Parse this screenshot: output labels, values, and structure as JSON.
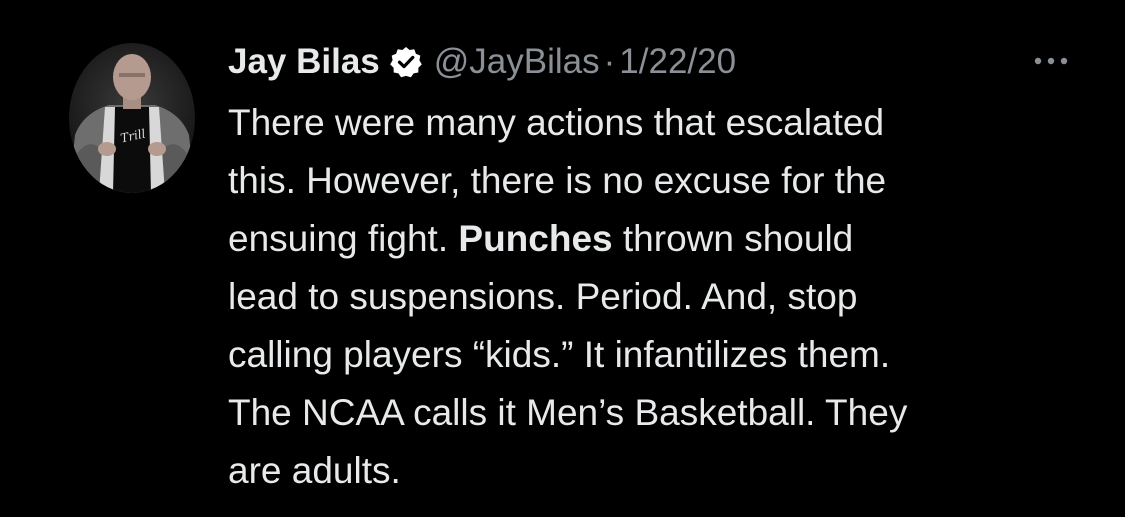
{
  "author": {
    "name": "Jay Bilas",
    "handle": "@JayBilas",
    "separator": "·",
    "date": "1/22/20",
    "verified": true,
    "avatar_icon": "profile-photo-icon",
    "avatar_shirt_text": "Trill"
  },
  "tweet": {
    "lines": [
      "There were many actions that escalated",
      "this. However, there is no excuse for the",
      "ensuing fight.",
      "Punches",
      "thrown should",
      "lead to suspensions. Period. And, stop",
      "calling players “kids.” It infantilizes them.",
      "The NCAA calls it Men’s Basketball. They",
      "are adults."
    ]
  },
  "actions": {
    "more_icon": "more-options-icon"
  },
  "colors": {
    "background": "#000000",
    "text": "#e7e9ea",
    "secondary": "#8b9096"
  }
}
